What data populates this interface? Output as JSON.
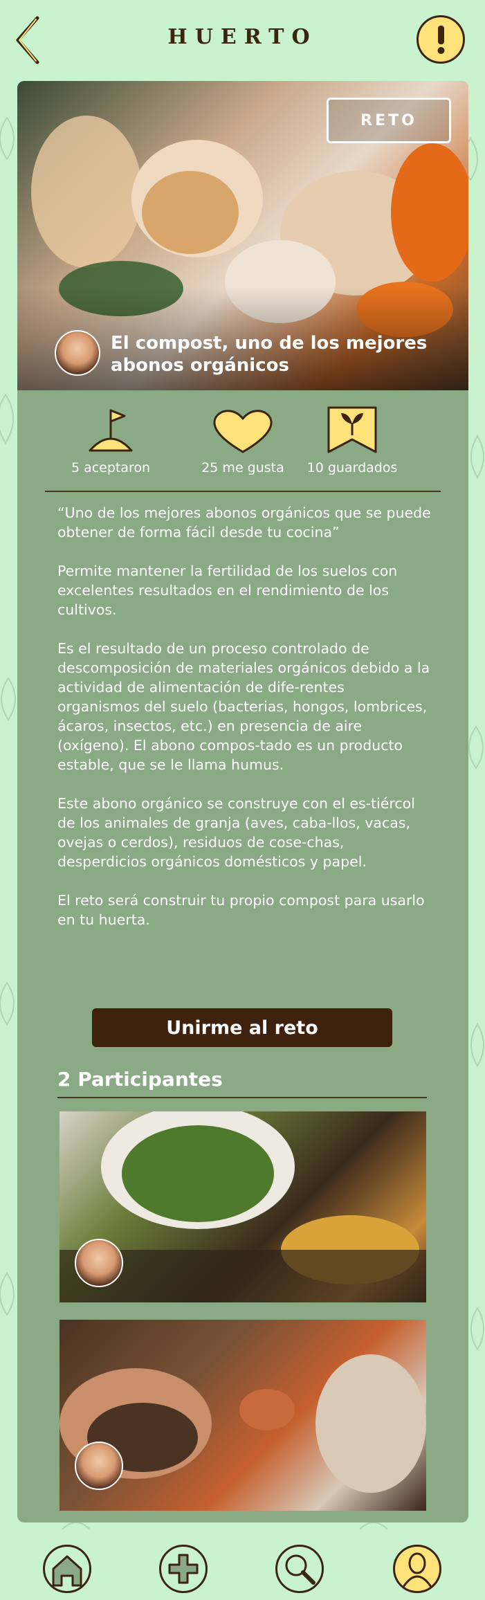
{
  "header": {
    "title": "HUERTO",
    "back_icon": "chevron-left-icon",
    "alert_icon": "exclamation-icon"
  },
  "hero": {
    "badge": "RETO",
    "title": "El compost, uno de los mejores abonos orgánicos",
    "image": "compost-eggshells-orange-peels"
  },
  "stats": [
    {
      "icon": "flag-icon",
      "label": "5 aceptaron"
    },
    {
      "icon": "heart-icon",
      "label": "25 me gusta"
    },
    {
      "icon": "bookmark-sprout-icon",
      "label": "10 guardados"
    }
  ],
  "body": {
    "paragraphs": [
      "“Uno de los mejores abonos orgánicos que se puede obtener de forma fácil desde tu cocina”",
      "Permite mantener la fertilidad de los suelos con excelentes resultados en el rendimiento de los cultivos.",
      "Es el resultado de un proceso controlado de descomposición de materiales orgánicos debido a la actividad de alimentación de dife-rentes organismos del suelo (bacterias, hongos, lombrices, ácaros, insectos, etc.) en presencia de aire (oxígeno). El abono compos-tado es un producto estable, que se le llama humus.",
      "Este abono orgánico se construye con el es-tiércol de los animales de granja (aves, caba-llos, vacas, ovejas o cerdos), residuos de cose-chas, desperdicios orgánicos domésticos y papel.",
      "El reto será construir tu propio compost para usarlo en tu huerta."
    ]
  },
  "join_button": "Unirme al reto",
  "participants": {
    "title": "2 Participantes",
    "photos": [
      "compost-bin-scraps",
      "hands-soil-compost"
    ]
  },
  "nav": [
    {
      "icon": "home-icon"
    },
    {
      "icon": "plus-icon"
    },
    {
      "icon": "search-icon"
    },
    {
      "icon": "user-icon"
    }
  ],
  "colors": {
    "background": "#c9f2cf",
    "card": "#8aa985",
    "accent_yellow": "#ffe27a",
    "dark_brown": "#3b2410"
  }
}
